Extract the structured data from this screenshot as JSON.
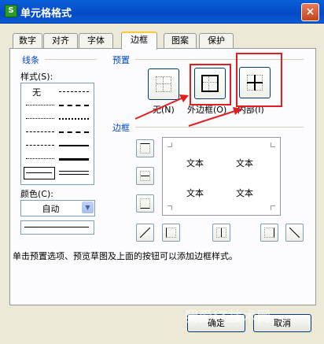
{
  "window": {
    "title": "单元格格式",
    "app_icon": "S",
    "close": "×"
  },
  "tabs": [
    "数字",
    "对齐",
    "字体",
    "边框",
    "图案",
    "保护"
  ],
  "active_tab": "边框",
  "lines_group": {
    "title": "线条",
    "style_label": "样式(S):",
    "none_label": "无",
    "color_label": "颜色(C):",
    "color_value": "自动"
  },
  "presets": {
    "title": "预置",
    "items": [
      {
        "label": "无(N)"
      },
      {
        "label": "外边框(O)"
      },
      {
        "label": "内部(I)"
      }
    ]
  },
  "border_group": {
    "title": "边框"
  },
  "preview": {
    "cells": [
      "文本",
      "文本",
      "文本",
      "文本"
    ]
  },
  "hint": "单击预置选项、预览草图及上面的按钮可以添加边框样式。",
  "buttons": {
    "ok": "确定",
    "cancel": "取消"
  },
  "watermark": "我爱IT技术网",
  "colors": {
    "accent": "#0046d5",
    "highlight": "#e31e1e"
  }
}
